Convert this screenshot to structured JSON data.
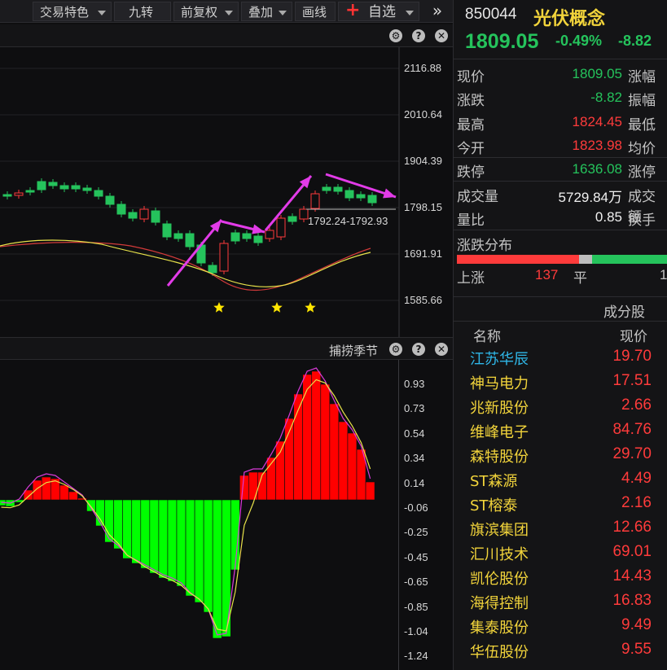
{
  "toolbar": {
    "items": [
      {
        "label": "交易特色",
        "has_caret": true
      },
      {
        "label": "九转",
        "has_caret": false
      },
      {
        "label": "前复权",
        "has_caret": true
      },
      {
        "label": "叠加",
        "has_caret": true
      },
      {
        "label": "画线",
        "has_caret": false
      },
      {
        "label": "自选",
        "has_caret": true
      }
    ],
    "more_glyph": "»"
  },
  "main_chart": {
    "y_ticks": [
      "2116.88",
      "2010.64",
      "1904.39",
      "1798.15",
      "1691.91",
      "1585.66"
    ],
    "price_line_label": "1792.24-1792.93",
    "icons": [
      "gear-icon",
      "help-icon",
      "close-icon"
    ]
  },
  "indicator": {
    "title": "捕捞季节",
    "y_ticks": [
      "0.93",
      "0.73",
      "0.54",
      "0.34",
      "0.14",
      "-0.06",
      "-0.25",
      "-0.45",
      "-0.65",
      "-0.85",
      "-1.04",
      "-1.24"
    ],
    "icons": [
      "gear-icon",
      "help-icon",
      "close-icon"
    ]
  },
  "quote": {
    "code": "850044",
    "name": "光伏概念",
    "price": "1809.05",
    "change_pct": "-0.49%",
    "change": "-8.82",
    "rows": [
      {
        "label": "现价",
        "value": "1809.05",
        "color": "green",
        "label2": "涨幅"
      },
      {
        "label": "涨跌",
        "value": "-8.82",
        "color": "green",
        "label2": "振幅"
      },
      {
        "label": "最高",
        "value": "1824.45",
        "color": "red",
        "label2": "最低"
      },
      {
        "label": "今开",
        "value": "1823.98",
        "color": "red",
        "label2": "均价"
      },
      {
        "label": "跌停",
        "value": "1636.08",
        "color": "green",
        "label2": "涨停"
      },
      {
        "label": "成交量",
        "value": "5729.84万",
        "color": "white",
        "label2": "成交额"
      },
      {
        "label": "量比",
        "value": "0.85",
        "color": "white",
        "label2": "换手"
      }
    ],
    "distribution_title": "涨跌分布",
    "up_label": "上涨",
    "up_count": "137",
    "flat_label": "平",
    "flat_count": "1"
  },
  "constituents": {
    "title": "成分股",
    "col_name": "名称",
    "col_price": "现价",
    "rows": [
      {
        "name": "江苏华辰",
        "price": "19.70",
        "name_color": "#2fb7e8"
      },
      {
        "name": "神马电力",
        "price": "17.51",
        "name_color": "#f2d43b"
      },
      {
        "name": "兆新股份",
        "price": "2.66",
        "name_color": "#f2d43b"
      },
      {
        "name": "维峰电子",
        "price": "84.76",
        "name_color": "#f2d43b"
      },
      {
        "name": "森特股份",
        "price": "29.70",
        "name_color": "#f2d43b"
      },
      {
        "name": "ST森源",
        "price": "4.49",
        "name_color": "#f2d43b"
      },
      {
        "name": "ST榕泰",
        "price": "2.16",
        "name_color": "#f2d43b"
      },
      {
        "name": "旗滨集团",
        "price": "12.66",
        "name_color": "#f2d43b"
      },
      {
        "name": "汇川技术",
        "price": "69.01",
        "name_color": "#f2d43b"
      },
      {
        "name": "凯伦股份",
        "price": "14.43",
        "name_color": "#f2d43b"
      },
      {
        "name": "海得控制",
        "price": "16.83",
        "name_color": "#f2d43b"
      },
      {
        "name": "集泰股份",
        "price": "9.49",
        "name_color": "#f2d43b"
      },
      {
        "name": "华伍股份",
        "price": "9.55",
        "name_color": "#f2d43b"
      }
    ]
  },
  "colors": {
    "up": "#ff3b3b",
    "down": "#25c35c",
    "arrow": "#e23be8",
    "star": "#ffe600",
    "ma_yellow": "#e8e24a",
    "ma_red": "#d23a3a"
  }
}
